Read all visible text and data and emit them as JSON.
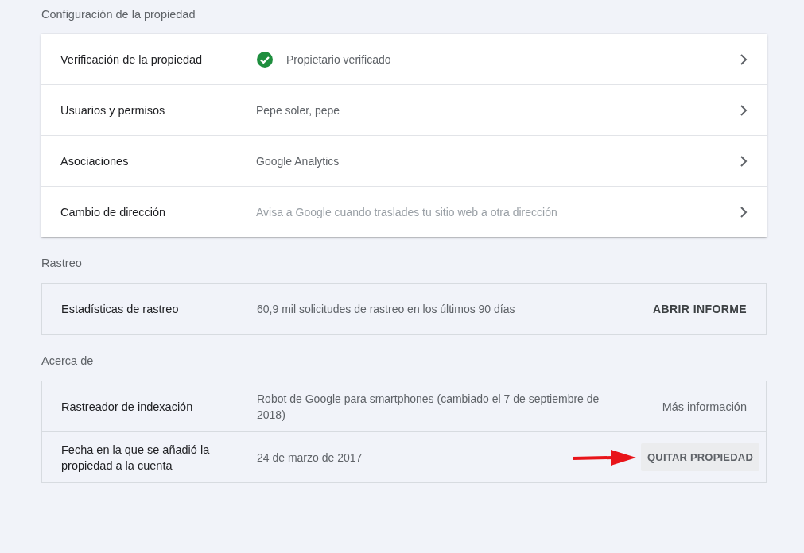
{
  "sections": [
    {
      "title": "Configuración de la propiedad",
      "rows": [
        {
          "label": "Verificación de la propiedad",
          "value": "Propietario verificado",
          "verified": true,
          "muted": false,
          "action": {
            "kind": "chevron"
          }
        },
        {
          "label": "Usuarios y permisos",
          "value": "Pepe soler, pepe",
          "verified": false,
          "muted": false,
          "action": {
            "kind": "chevron"
          }
        },
        {
          "label": "Asociaciones",
          "value": "Google Analytics",
          "verified": false,
          "muted": false,
          "action": {
            "kind": "chevron"
          }
        },
        {
          "label": "Cambio de dirección",
          "value": "Avisa a Google cuando traslades tu sitio web a otra dirección",
          "verified": false,
          "muted": true,
          "action": {
            "kind": "chevron"
          }
        }
      ]
    },
    {
      "title": "Rastreo",
      "rows": [
        {
          "label": "Estadísticas de rastreo",
          "value": "60,9 mil solicitudes de rastreo en los últimos 90 días",
          "verified": false,
          "muted": false,
          "action": {
            "kind": "text-button",
            "label": "ABRIR INFORME"
          }
        }
      ]
    },
    {
      "title": "Acerca de",
      "rows": [
        {
          "label": "Rastreador de indexación",
          "value": "Robot de Google para smartphones (cambiado el 7 de septiembre de 2018)",
          "verified": false,
          "muted": false,
          "action": {
            "kind": "link",
            "label": "Más información"
          }
        },
        {
          "label": "Fecha en la que se añadió la propiedad a la cuenta",
          "value": "24 de marzo de 2017",
          "verified": false,
          "muted": false,
          "action": {
            "kind": "filled-button",
            "label": "QUITAR PROPIEDAD",
            "annotated": true
          }
        }
      ]
    }
  ]
}
